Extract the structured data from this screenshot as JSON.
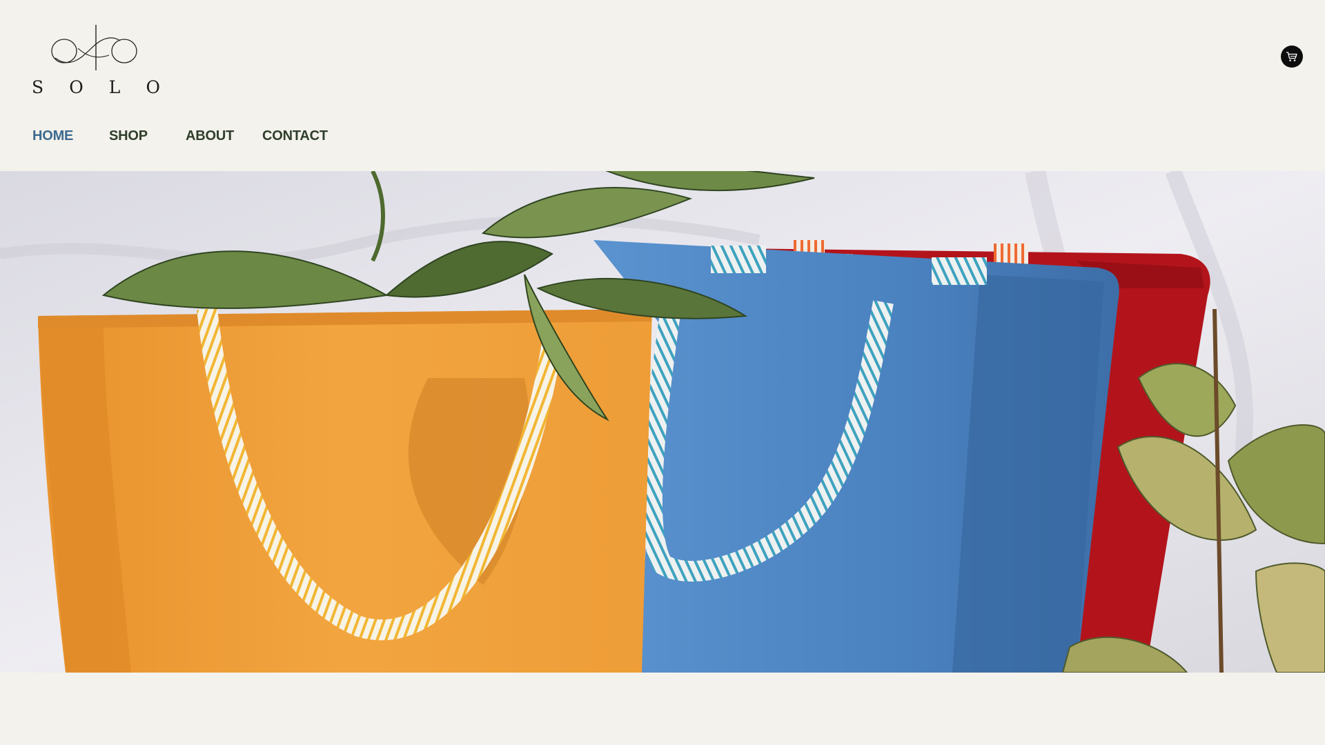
{
  "brand": {
    "name_letters": [
      "S",
      "O",
      "L",
      "O"
    ]
  },
  "nav": {
    "items": [
      {
        "label": "HOME",
        "active": true
      },
      {
        "label": "SHOP",
        "active": false
      },
      {
        "label": "ABOUT",
        "active": false
      },
      {
        "label": "CONTACT",
        "active": false
      }
    ]
  },
  "cart": {
    "icon": "shopping-cart-icon"
  },
  "hero": {
    "image": "hero-image",
    "description_colors": {
      "left_bag": "#f1a23c",
      "middle_bag": "#4f86c2",
      "right_bag": "#b8141a",
      "backdrop": "#eceaf0"
    }
  },
  "colors": {
    "page_background": "#f4f2ec",
    "nav_text": "#2f3e2c",
    "nav_active": "#3d6a8e",
    "cart_background": "#0d0d0d"
  }
}
